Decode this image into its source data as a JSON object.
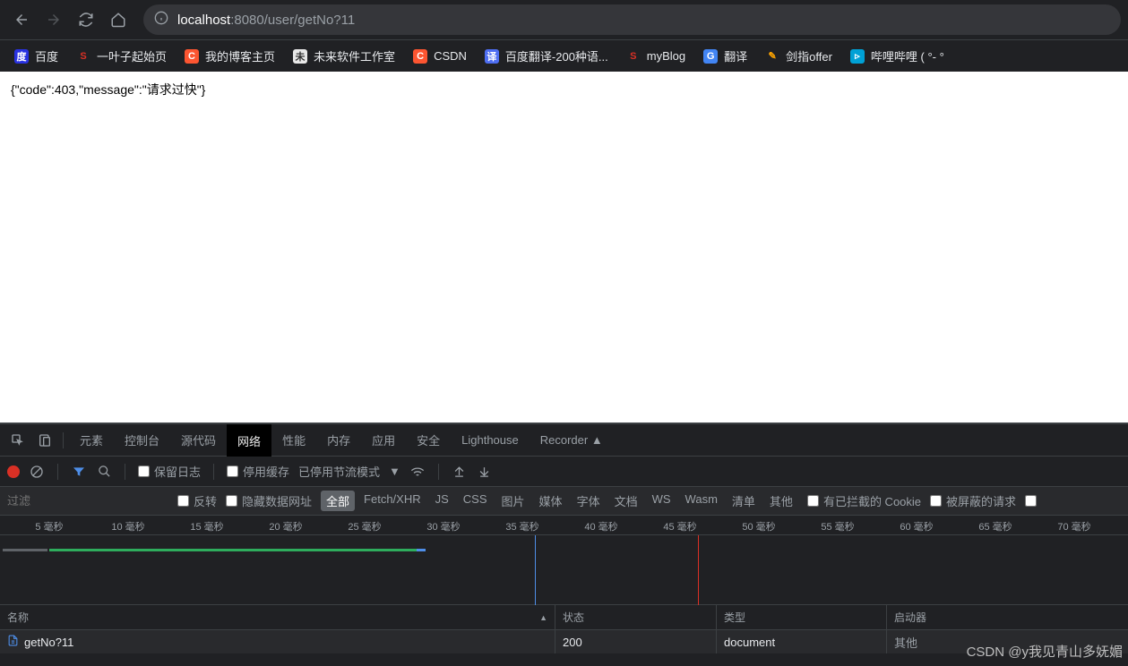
{
  "url": {
    "host": "localhost",
    "port": ":8080",
    "path": "/user/getNo?11"
  },
  "bookmarks": [
    {
      "label": "百度",
      "bg": "#2932e1",
      "fg": "#fff",
      "icon": "度"
    },
    {
      "label": "一叶子起始页",
      "bg": "transparent",
      "fg": "#d93025",
      "icon": "S"
    },
    {
      "label": "我的博客主页",
      "bg": "#fc5531",
      "fg": "#fff",
      "icon": "C"
    },
    {
      "label": "未来软件工作室",
      "bg": "#e8e8e8",
      "fg": "#333",
      "icon": "未"
    },
    {
      "label": "CSDN",
      "bg": "#fc5531",
      "fg": "#fff",
      "icon": "C"
    },
    {
      "label": "百度翻译-200种语...",
      "bg": "#4e6ef2",
      "fg": "#fff",
      "icon": "译"
    },
    {
      "label": "myBlog",
      "bg": "transparent",
      "fg": "#d93025",
      "icon": "S"
    },
    {
      "label": "翻译",
      "bg": "#4285f4",
      "fg": "#fff",
      "icon": "G"
    },
    {
      "label": "剑指offer",
      "bg": "transparent",
      "fg": "#ffa500",
      "icon": "✎"
    },
    {
      "label": "哔哩哔哩 (  °-  °",
      "bg": "#00a1d6",
      "fg": "#fff",
      "icon": "▹"
    }
  ],
  "page_body": "{\"code\":403,\"message\":\"请求过快\"}",
  "devtools": {
    "tabs": [
      "元素",
      "控制台",
      "源代码",
      "网络",
      "性能",
      "内存",
      "应用",
      "安全",
      "Lighthouse",
      "Recorder ▲"
    ],
    "active_tab": "网络",
    "toolbar": {
      "preserve_log": "保留日志",
      "disable_cache": "停用缓存",
      "throttling": "已停用节流模式"
    },
    "filter": {
      "placeholder": "过滤",
      "invert": "反转",
      "hide_data": "隐藏数据网址",
      "types": [
        "全部",
        "Fetch/XHR",
        "JS",
        "CSS",
        "图片",
        "媒体",
        "字体",
        "文档",
        "WS",
        "Wasm",
        "清单",
        "其他"
      ],
      "active_type": "全部",
      "blocked_cookies": "有已拦截的 Cookie",
      "blocked_requests": "被屏蔽的请求"
    },
    "timeline_ticks": [
      "5 毫秒",
      "10 毫秒",
      "15 毫秒",
      "20 毫秒",
      "25 毫秒",
      "30 毫秒",
      "35 毫秒",
      "40 毫秒",
      "45 毫秒",
      "50 毫秒",
      "55 毫秒",
      "60 毫秒",
      "65 毫秒",
      "70 毫秒"
    ],
    "table": {
      "headers": [
        "名称",
        "状态",
        "类型",
        "启动器"
      ],
      "row": {
        "name": "getNo?11",
        "status": "200",
        "type": "document",
        "initiator": "其他"
      }
    }
  },
  "watermark": "CSDN @y我见青山多妩媚"
}
